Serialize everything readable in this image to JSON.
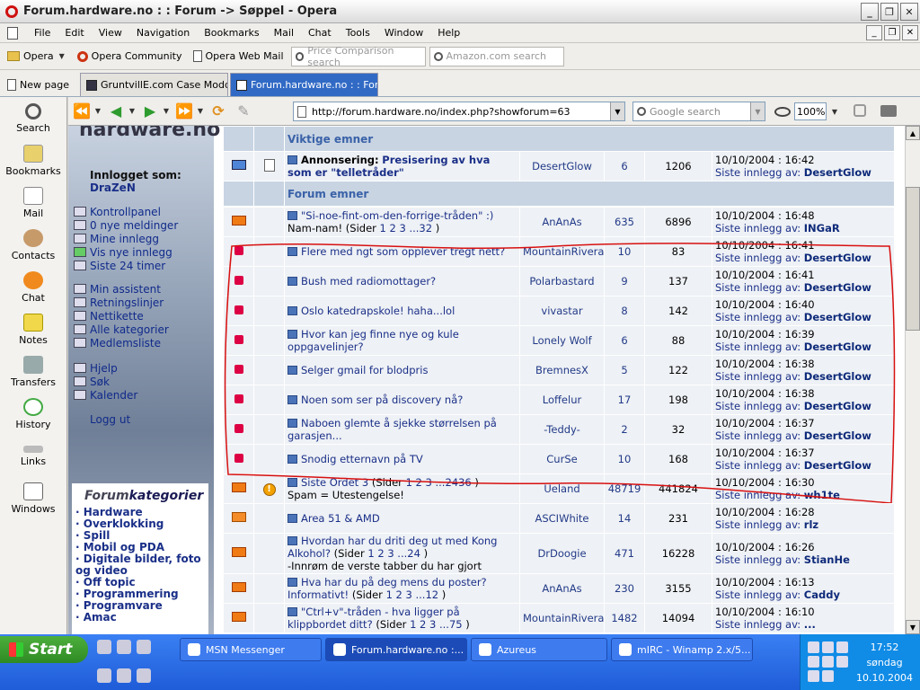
{
  "window": {
    "title": "Forum.hardware.no : : Forum -> Søppel - Opera"
  },
  "menu": [
    "File",
    "Edit",
    "View",
    "Navigation",
    "Bookmarks",
    "Mail",
    "Chat",
    "Tools",
    "Window",
    "Help"
  ],
  "personal_bar": {
    "opera": "Opera",
    "community": "Opera Community",
    "webmail": "Opera Web Mail",
    "price_search_placeholder": "Price Comparison search",
    "amazon_search_placeholder": "Amazon.com search"
  },
  "tabs": {
    "new_page": "New page",
    "items": [
      {
        "label": "GruntvillE.com Case Moddi..."
      },
      {
        "label": "Forum.hardware.no : : For..."
      }
    ]
  },
  "panel": [
    "Search",
    "Bookmarks",
    "Mail",
    "Contacts",
    "Chat",
    "Notes",
    "Transfers",
    "History",
    "Links",
    "Windows"
  ],
  "nav": {
    "url": "http://forum.hardware.no/index.php?showforum=63",
    "search_placeholder": "Google search",
    "zoom": "100%"
  },
  "sidebar": {
    "logo": "hardware.no",
    "login_label": "Innlogget som:",
    "user": "DraZeN",
    "group1": [
      "Kontrollpanel",
      "0 nye meldinger",
      "Mine innlegg",
      "Vis nye innlegg",
      "Siste 24 timer"
    ],
    "group2": [
      "Min assistent",
      "Retningslinjer",
      "Nettikette",
      "Alle kategorier",
      "Medlemsliste"
    ],
    "group3": [
      "Hjelp",
      "Søk",
      "Kalender"
    ],
    "logout": "Logg ut",
    "cat_title_a": "Forum",
    "cat_title_b": "kategorier",
    "categories": [
      "Hardware",
      "Overklokking",
      "Spill",
      "Mobil og PDA",
      "Digitale bilder, foto og video",
      "Off topic",
      "Programmering",
      "Programvare",
      "Amac"
    ]
  },
  "forum": {
    "section_important": "Viktige emner",
    "section_forum": "Forum emner",
    "announcement": {
      "prefix": "Annonsering:",
      "title": "Presisering av hva som er \"telletråder\"",
      "author": "DesertGlow",
      "replies": "6",
      "views": "1206",
      "date": "10/10/2004 : 16:42",
      "last_label": "Siste innlegg av:",
      "last_by": "DesertGlow"
    },
    "topics": [
      {
        "title": "\"Si-noe-fint-om-den-forrige-tråden\" :)",
        "sub": "Nam-nam! (Sider",
        "pages": "1 2 3 ...32",
        "tail": " )",
        "author": "AnAnAs",
        "replies": "635",
        "views": "6896",
        "date": "10/10/2004 : 16:48",
        "last_by": "INGaR"
      },
      {
        "title": "Flere med ngt som opplever tregt nett?",
        "author": "MountainRivera",
        "replies": "10",
        "views": "83",
        "date": "10/10/2004 : 16:41",
        "last_by": "DesertGlow"
      },
      {
        "title": "Bush med radiomottager?",
        "author": "Polarbastard",
        "replies": "9",
        "views": "137",
        "date": "10/10/2004 : 16:41",
        "last_by": "DesertGlow"
      },
      {
        "title": "Oslo katedrapskole! haha...lol",
        "author": "vivastar",
        "replies": "8",
        "views": "142",
        "date": "10/10/2004 : 16:40",
        "last_by": "DesertGlow"
      },
      {
        "title": "Hvor kan jeg finne nye og kule oppgavelinjer?",
        "author": "Lonely Wolf",
        "replies": "6",
        "views": "88",
        "date": "10/10/2004 : 16:39",
        "last_by": "DesertGlow"
      },
      {
        "title": "Selger gmail for blodpris",
        "author": "BremnesX",
        "replies": "5",
        "views": "122",
        "date": "10/10/2004 : 16:38",
        "last_by": "DesertGlow"
      },
      {
        "title": "Noen som ser på discovery nå?",
        "author": "Loffelur",
        "replies": "17",
        "views": "198",
        "date": "10/10/2004 : 16:38",
        "last_by": "DesertGlow"
      },
      {
        "title": "Naboen glemte å sjekke størrelsen på garasjen...",
        "author": "-Teddy-",
        "replies": "2",
        "views": "32",
        "date": "10/10/2004 : 16:37",
        "last_by": "DesertGlow"
      },
      {
        "title": "Snodig etternavn på TV",
        "author": "CurSe",
        "replies": "10",
        "views": "168",
        "date": "10/10/2004 : 16:37",
        "last_by": "DesertGlow"
      },
      {
        "title": "Siste Ordet 3",
        "sub": "(Sider",
        "pages": "1 2 3 ...2436",
        "tail": " )",
        "desc": "Spam = Utestengelse!",
        "author": "Ueland",
        "replies": "48719",
        "views": "441824",
        "date": "10/10/2004 : 16:30",
        "last_by": "wh1te"
      },
      {
        "title": "Area 51 & AMD",
        "author": "ASCIWhite",
        "replies": "14",
        "views": "231",
        "date": "10/10/2004 : 16:28",
        "last_by": "rlz"
      },
      {
        "title": "Hvordan har du driti deg ut med Kong Alkohol?",
        "sub": "(Sider",
        "pages": "1 2 3 ...24",
        "tail": " )",
        "desc": "-Innrøm de verste tabber du har gjort",
        "author": "DrDoogie",
        "replies": "471",
        "views": "16228",
        "date": "10/10/2004 : 16:26",
        "last_by": "StianHe"
      },
      {
        "title": "Hva har du på deg mens du poster? Informativt!",
        "sub": "(Sider",
        "pages": "1 2 3 ...12",
        "tail": " )",
        "author": "AnAnAs",
        "replies": "230",
        "views": "3155",
        "date": "10/10/2004 : 16:13",
        "last_by": "Caddy"
      },
      {
        "title": "\"Ctrl+v\"-tråden - hva ligger på klippbordet ditt?",
        "sub": "(Sider",
        "pages": "1 2 3 ...75",
        "tail": " )",
        "author": "MountainRivera",
        "replies": "1482",
        "views": "14094",
        "date": "10/10/2004 : 16:10",
        "last_by": "..."
      }
    ]
  },
  "taskbar": {
    "start": "Start",
    "buttons": [
      "MSN Messenger",
      "Forum.hardware.no :...",
      "Azureus",
      "mIRC - Winamp 2.x/5..."
    ],
    "time": "17:52",
    "day": "søndag",
    "date": "10.10.2004"
  }
}
